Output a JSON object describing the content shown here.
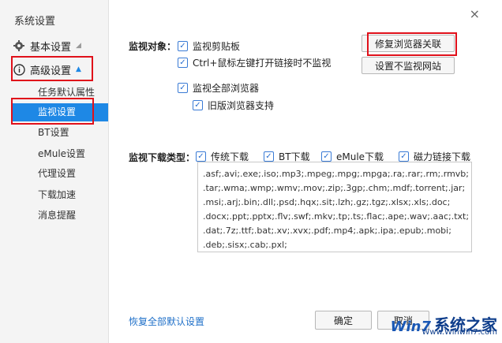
{
  "sidebar": {
    "title": "系统设置",
    "sections": [
      {
        "label": "基本设置",
        "icon": "gear-icon"
      },
      {
        "label": "高级设置",
        "icon": "info-icon"
      }
    ],
    "items": [
      "任务默认属性",
      "监视设置",
      "BT设置",
      "eMule设置",
      "代理设置",
      "下载加速",
      "消息提醒"
    ],
    "selected_item": "监视设置"
  },
  "monitor": {
    "objects_label": "监视对象：",
    "clipboard": "监视剪贴板",
    "ctrl_click": "Ctrl+鼠标左键打开链接时不监视",
    "all_browsers": "监视全部浏览器",
    "legacy_browser": "旧版浏览器支持",
    "repair_button": "修复浏览器关联",
    "exclude_sites_button": "设置不监视网站"
  },
  "download_types": {
    "label": "监视下载类型：",
    "traditional": "传统下载",
    "bt": "BT下载",
    "emule": "eMule下载",
    "magnet": "磁力链接下载",
    "extensions": ".asf;.avi;.exe;.iso;.mp3;.mpeg;.mpg;.mpga;.ra;.rar;.rm;.rmvb;\n.tar;.wma;.wmp;.wmv;.mov;.zip;.3gp;.chm;.mdf;.torrent;.jar;\n.msi;.arj;.bin;.dll;.psd;.hqx;.sit;.lzh;.gz;.tgz;.xlsx;.xls;.doc;\n.docx;.ppt;.pptx;.flv;.swf;.mkv;.tp;.ts;.flac;.ape;.wav;.aac;.txt;\n.dat;.7z;.ttf;.bat;.xv;.xvx;.pdf;.mp4;.apk;.ipa;.epub;.mobi;\n.deb;.sisx;.cab;.pxl;"
  },
  "footer": {
    "restore_link": "恢复全部默认设置",
    "ok_button": "确定",
    "cancel_button": "取消"
  },
  "watermark": {
    "logo": "Win7",
    "text": "系统之家",
    "url": "Www.Winwin7.com"
  },
  "window": {
    "close": "×"
  },
  "colors": {
    "accent": "#1e88e5",
    "highlight_box": "#e0101a",
    "link": "#1e6fc8"
  }
}
